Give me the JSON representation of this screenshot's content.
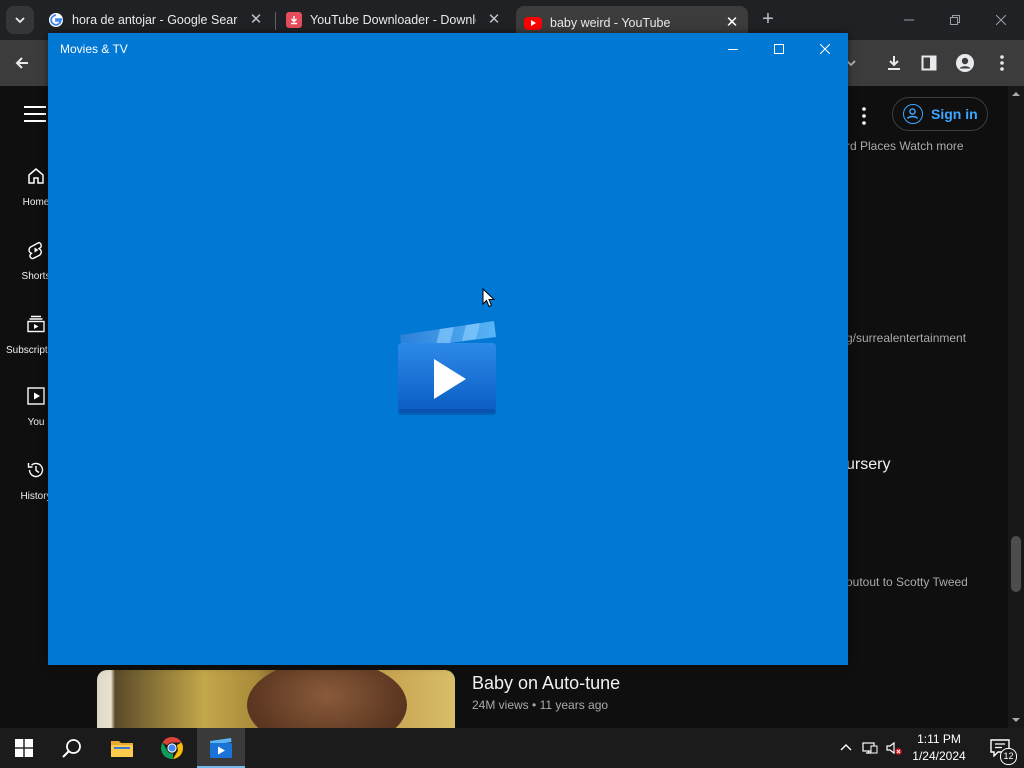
{
  "browser": {
    "tabs": [
      {
        "title": "hora de antojar - Google Search",
        "icon": "google-icon",
        "active": false
      },
      {
        "title": "YouTube Downloader - Download",
        "icon": "downloader-icon",
        "active": false
      },
      {
        "title": "baby weird - YouTube",
        "icon": "youtube-icon",
        "active": true
      }
    ],
    "new_tab_label": "+"
  },
  "youtube": {
    "nav": [
      {
        "label": "Home",
        "icon": "home-icon"
      },
      {
        "label": "Shorts",
        "icon": "shorts-icon"
      },
      {
        "label": "Subscriptions",
        "icon": "subscriptions-icon"
      },
      {
        "label": "You",
        "icon": "you-icon"
      },
      {
        "label": "History",
        "icon": "history-icon"
      }
    ],
    "sign_in_label": "Sign in",
    "right_snippets": {
      "snippet1": "rd Places Watch more",
      "snippet2": "g/surrealentertainment",
      "title_fragment": "ursery",
      "snippet3": "outout to Scotty Tweed"
    },
    "video": {
      "title": "Baby on Auto-tune",
      "views": "24M views",
      "age": "11 years ago"
    }
  },
  "movies_tv": {
    "title": "Movies & TV",
    "accent": "#0078d4"
  },
  "taskbar": {
    "time": "1:11 PM",
    "date": "1/24/2024",
    "notification_count": "12",
    "apps": [
      "start-icon",
      "search-icon",
      "file-explorer-icon",
      "chrome-icon",
      "movies-tv-icon"
    ]
  }
}
